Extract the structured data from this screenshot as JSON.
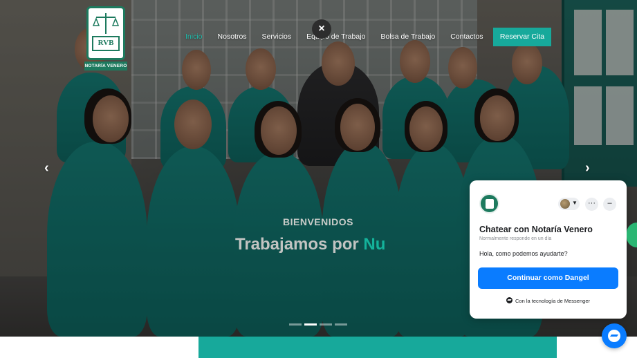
{
  "logo": {
    "monogram": "RVB",
    "caption": "NOTARÍA VENERO"
  },
  "nav": {
    "items": [
      {
        "label": "Inicio",
        "active": true
      },
      {
        "label": "Nosotros",
        "active": false
      },
      {
        "label": "Servicios",
        "active": false
      },
      {
        "label": "Equipo de Trabajo",
        "active": false
      },
      {
        "label": "Bolsa de Trabajo",
        "active": false
      },
      {
        "label": "Contactos",
        "active": false
      }
    ],
    "cta_label": "Reservar Cita",
    "close_icon": "×"
  },
  "hero": {
    "kicker": "BIENVENIDOS",
    "headline_main": "Trabajamos por ",
    "headline_accent": "Nu",
    "prev_icon": "‹",
    "next_icon": "›",
    "slides_total": 4,
    "slide_active": 2
  },
  "chat": {
    "title": "Chatear con Notaría Venero",
    "subtitle": "Normalmente responde en un día",
    "greeting": "Hola, como podemos ayudarte?",
    "continue_label": "Continuar como Dangel",
    "powered_by": "Con la tecnología de Messenger",
    "more_icon": "···",
    "minimize_icon": "–",
    "caret_icon": "▼"
  },
  "colors": {
    "accent": "#17a99b",
    "nav_active": "#1fb8a8",
    "messenger_blue": "#0a7cff",
    "logo_green": "#1d7a5e"
  }
}
